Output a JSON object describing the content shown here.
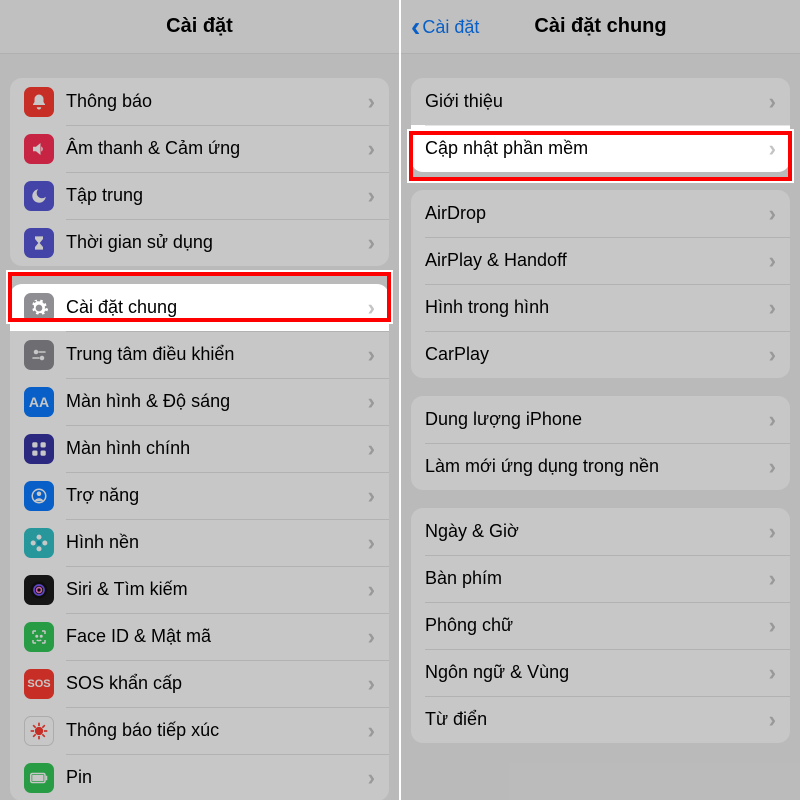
{
  "left": {
    "title": "Cài đặt",
    "groups": [
      [
        {
          "id": "notifications",
          "icon": "bell",
          "bg": "#ff3b30",
          "label": "Thông báo"
        },
        {
          "id": "sounds",
          "icon": "speaker",
          "bg": "#ff2d55",
          "label": "Âm thanh & Cảm ứng"
        },
        {
          "id": "focus",
          "icon": "moon",
          "bg": "#5856d6",
          "label": "Tập trung"
        },
        {
          "id": "screentime",
          "icon": "hourglass",
          "bg": "#5856d6",
          "label": "Thời gian sử dụng"
        }
      ],
      [
        {
          "id": "general",
          "icon": "gear",
          "bg": "#8e8e93",
          "label": "Cài đặt chung",
          "highlight": true
        },
        {
          "id": "control",
          "icon": "switches",
          "bg": "#8e8e93",
          "label": "Trung tâm điều khiển"
        },
        {
          "id": "display",
          "icon": "aa",
          "bg": "#0a7aff",
          "label": "Màn hình & Độ sáng"
        },
        {
          "id": "home",
          "icon": "grid",
          "bg": "#3634a3",
          "label": "Màn hình chính"
        },
        {
          "id": "access",
          "icon": "person",
          "bg": "#0a7aff",
          "label": "Trợ năng"
        },
        {
          "id": "wallpaper",
          "icon": "flower",
          "bg": "#33c2c8",
          "label": "Hình nền"
        },
        {
          "id": "siri",
          "icon": "siri",
          "bg": "#1b1b1d",
          "label": "Siri & Tìm kiếm"
        },
        {
          "id": "faceid",
          "icon": "faceid",
          "bg": "#34c759",
          "label": "Face ID & Mật mã"
        },
        {
          "id": "sos",
          "icon": "sos",
          "bg": "#ff3b30",
          "label": "SOS khẩn cấp"
        },
        {
          "id": "exposure",
          "icon": "virus",
          "bg": "#ffffff",
          "label": "Thông báo tiếp xúc"
        },
        {
          "id": "battery",
          "icon": "battery",
          "bg": "#34c759",
          "label": "Pin"
        }
      ]
    ]
  },
  "right": {
    "back": "Cài đặt",
    "title": "Cài đặt chung",
    "groups": [
      [
        {
          "id": "about",
          "label": "Giới thiệu"
        },
        {
          "id": "update",
          "label": "Cập nhật phần mềm",
          "highlight": true
        }
      ],
      [
        {
          "id": "airdrop",
          "label": "AirDrop"
        },
        {
          "id": "airplay",
          "label": "AirPlay & Handoff"
        },
        {
          "id": "pip",
          "label": "Hình trong hình"
        },
        {
          "id": "carplay",
          "label": "CarPlay"
        }
      ],
      [
        {
          "id": "storage",
          "label": "Dung lượng iPhone"
        },
        {
          "id": "bgrefresh",
          "label": "Làm mới ứng dụng trong nền"
        }
      ],
      [
        {
          "id": "datetime",
          "label": "Ngày & Giờ"
        },
        {
          "id": "keyboard",
          "label": "Bàn phím"
        },
        {
          "id": "font",
          "label": "Phông chữ"
        },
        {
          "id": "language",
          "label": "Ngôn ngữ & Vùng"
        },
        {
          "id": "dict",
          "label": "Từ điển"
        }
      ]
    ]
  }
}
